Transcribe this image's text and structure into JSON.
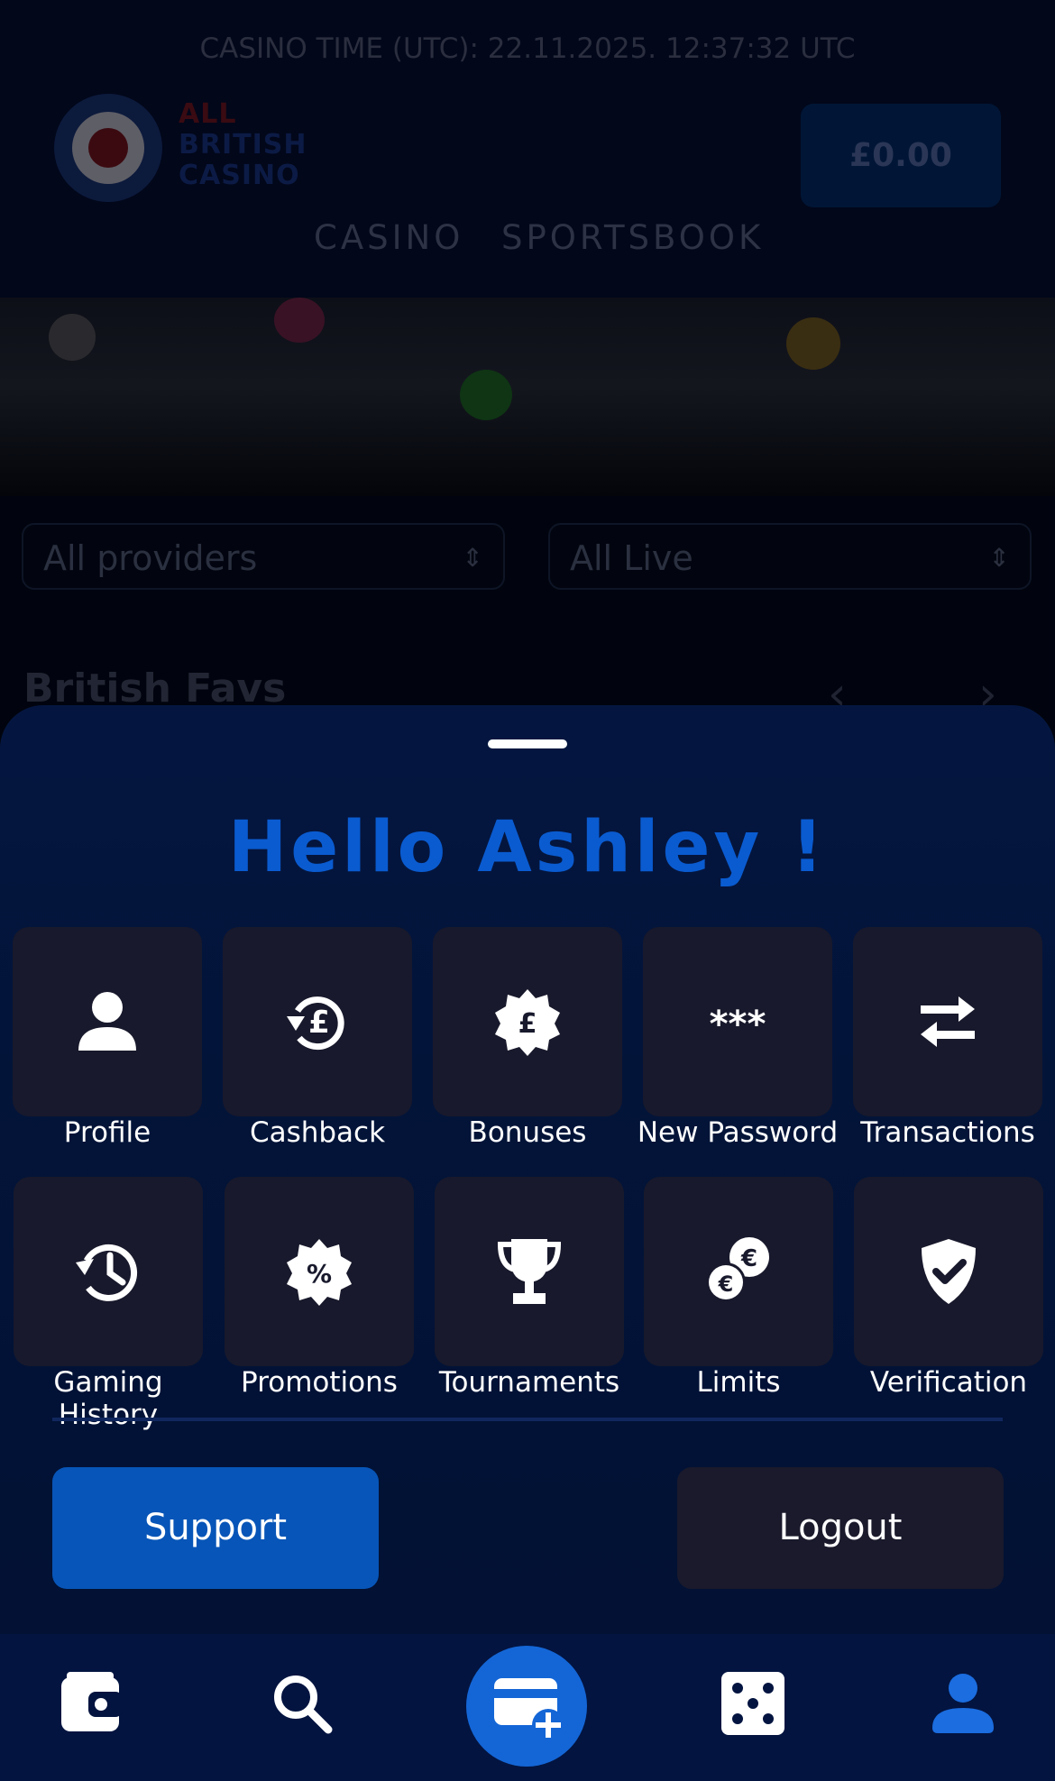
{
  "header": {
    "casino_time": "CASINO TIME (UTC): 22.11.2025. 12:37:32 UTC",
    "logo_lines": [
      "ALL",
      "BRITISH",
      "CASINO"
    ],
    "balance": "£0.00",
    "nav": [
      "CASINO",
      "SPORTSBOOK"
    ]
  },
  "filters": {
    "providers": "All providers",
    "live": "All Live"
  },
  "section": {
    "title": "British Favs"
  },
  "sheet": {
    "greeting": "Hello Ashley !",
    "menu": [
      {
        "label": "Profile",
        "icon": "user-icon"
      },
      {
        "label": "Cashback",
        "icon": "cashback-icon"
      },
      {
        "label": "Bonuses",
        "icon": "bonus-badge-icon"
      },
      {
        "label": "New Password",
        "icon": "password-icon"
      },
      {
        "label": "Transactions",
        "icon": "transfer-arrows-icon"
      },
      {
        "label": "Gaming History",
        "icon": "history-icon"
      },
      {
        "label": "Promotions",
        "icon": "percent-badge-icon"
      },
      {
        "label": "Tournaments",
        "icon": "trophy-icon"
      },
      {
        "label": "Limits",
        "icon": "euro-coins-icon"
      },
      {
        "label": "Verification",
        "icon": "shield-check-icon"
      }
    ],
    "support_label": "Support",
    "logout_label": "Logout"
  },
  "bottom_nav": {
    "items": [
      "wallet-icon",
      "search-icon",
      "deposit-card-icon",
      "dice-icon",
      "account-icon"
    ],
    "active": "account-icon"
  },
  "colors": {
    "accent": "#0a5bd0",
    "support": "#0755b8",
    "sheet_bg": "#041640",
    "tile_bg": "#18192c",
    "fab": "#1466d6",
    "active_nav": "#1b6de0"
  }
}
